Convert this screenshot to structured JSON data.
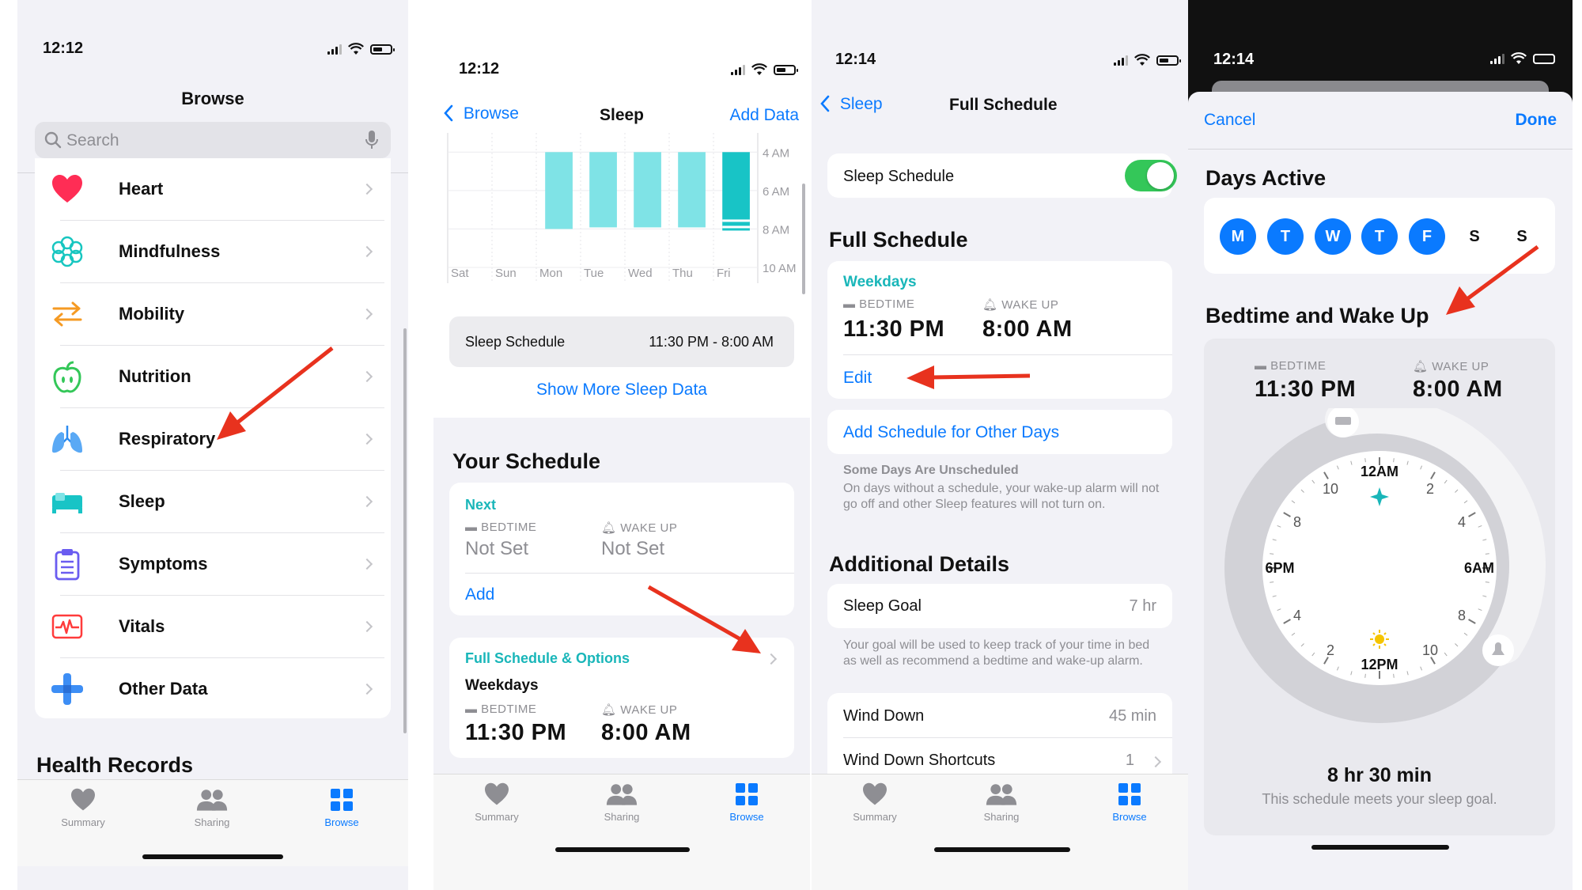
{
  "screen1": {
    "status_time": "12:12",
    "title": "Browse",
    "search_placeholder": "Search",
    "categories": [
      {
        "label": "Heart",
        "icon": "heart-icon"
      },
      {
        "label": "Mindfulness",
        "icon": "mindfulness-icon"
      },
      {
        "label": "Mobility",
        "icon": "mobility-icon"
      },
      {
        "label": "Nutrition",
        "icon": "nutrition-apple-icon"
      },
      {
        "label": "Respiratory",
        "icon": "lungs-icon"
      },
      {
        "label": "Sleep",
        "icon": "bed-icon"
      },
      {
        "label": "Symptoms",
        "icon": "clipboard-icon"
      },
      {
        "label": "Vitals",
        "icon": "vitals-waveform-icon"
      },
      {
        "label": "Other Data",
        "icon": "plus-icon"
      }
    ],
    "section_title": "Health Records",
    "tabs": [
      "Summary",
      "Sharing",
      "Browse"
    ]
  },
  "screen2": {
    "status_time": "12:12",
    "back_label": "Browse",
    "title": "Sleep",
    "action": "Add Data",
    "chart_data": {
      "type": "bar",
      "categories": [
        "Sat",
        "Sun",
        "Mon",
        "Tue",
        "Wed",
        "Thu",
        "Fri"
      ],
      "y_tick_labels": [
        "4 AM",
        "6 AM",
        "8 AM",
        "10 AM"
      ],
      "series": [
        {
          "values_start": [
            null,
            null,
            "4 AM",
            "4 AM",
            "4 AM",
            "4 AM",
            "4 AM"
          ],
          "values_end": [
            null,
            null,
            "8 AM",
            "7:55 AM",
            "7:55 AM",
            "7:55 AM",
            "8:05 AM"
          ]
        }
      ],
      "color": "#7fe3e6"
    },
    "schedule_label": "Sleep Schedule",
    "schedule_value": "11:30 PM - 8:00 AM",
    "show_more": "Show More Sleep Data",
    "your_schedule": "Your Schedule",
    "next_label": "Next",
    "bedtime_label": "BEDTIME",
    "wakeup_label": "WAKE UP",
    "not_set": "Not Set",
    "add_label": "Add",
    "full_schedule_label": "Full Schedule & Options",
    "weekdays": "Weekdays",
    "bedtime": "11:30 PM",
    "wakeup": "8:00 AM",
    "tabs": [
      "Summary",
      "Sharing",
      "Browse"
    ]
  },
  "screen3": {
    "status_time": "12:14",
    "back_label": "Sleep",
    "title": "Full Schedule",
    "toggle_label": "Sleep Schedule",
    "toggle_on": true,
    "section_full": "Full Schedule",
    "weekdays": "Weekdays",
    "bedtime_label": "BEDTIME",
    "wakeup_label": "WAKE UP",
    "bedtime": "11:30 PM",
    "wakeup": "8:00 AM",
    "edit": "Edit",
    "add_other": "Add Schedule for Other Days",
    "unscheduled_title": "Some Days Are Unscheduled",
    "unscheduled_body": "On days without a schedule, your wake-up alarm will not go off and other Sleep features will not turn on.",
    "additional": "Additional Details",
    "sleep_goal_label": "Sleep Goal",
    "sleep_goal_value": "7 hr",
    "goal_note": "Your goal will be used to keep track of your time in bed as well as recommend a bedtime and wake-up alarm.",
    "wind_down_label": "Wind Down",
    "wind_down_value": "45 min",
    "shortcuts_label": "Wind Down Shortcuts",
    "shortcuts_value": "1",
    "tabs": [
      "Summary",
      "Sharing",
      "Browse"
    ]
  },
  "screen4": {
    "status_time": "12:14",
    "cancel": "Cancel",
    "done": "Done",
    "days_active": "Days Active",
    "days": [
      {
        "letter": "M",
        "active": true
      },
      {
        "letter": "T",
        "active": true
      },
      {
        "letter": "W",
        "active": true
      },
      {
        "letter": "T",
        "active": true
      },
      {
        "letter": "F",
        "active": true
      },
      {
        "letter": "S",
        "active": false
      },
      {
        "letter": "S",
        "active": false
      }
    ],
    "section": "Bedtime and Wake Up",
    "bedtime_label": "BEDTIME",
    "wakeup_label": "WAKE UP",
    "bedtime": "11:30 PM",
    "wakeup": "8:00 AM",
    "clock": {
      "top": "12AM",
      "bottom": "12PM",
      "left": "6PM",
      "right": "6AM",
      "n10a": "10",
      "n2a": "2",
      "n8a": "8",
      "n4a": "4",
      "n4b": "4",
      "n8b": "8",
      "n2b": "2",
      "n10b": "10"
    },
    "duration": "8 hr 30 min",
    "note": "This schedule meets your sleep goal."
  },
  "colors": {
    "blue": "#0a7aff",
    "teal": "#19b6b9",
    "bar": "#7fe3e6",
    "green_toggle": "#34c759",
    "arrow": "#e8321e"
  }
}
